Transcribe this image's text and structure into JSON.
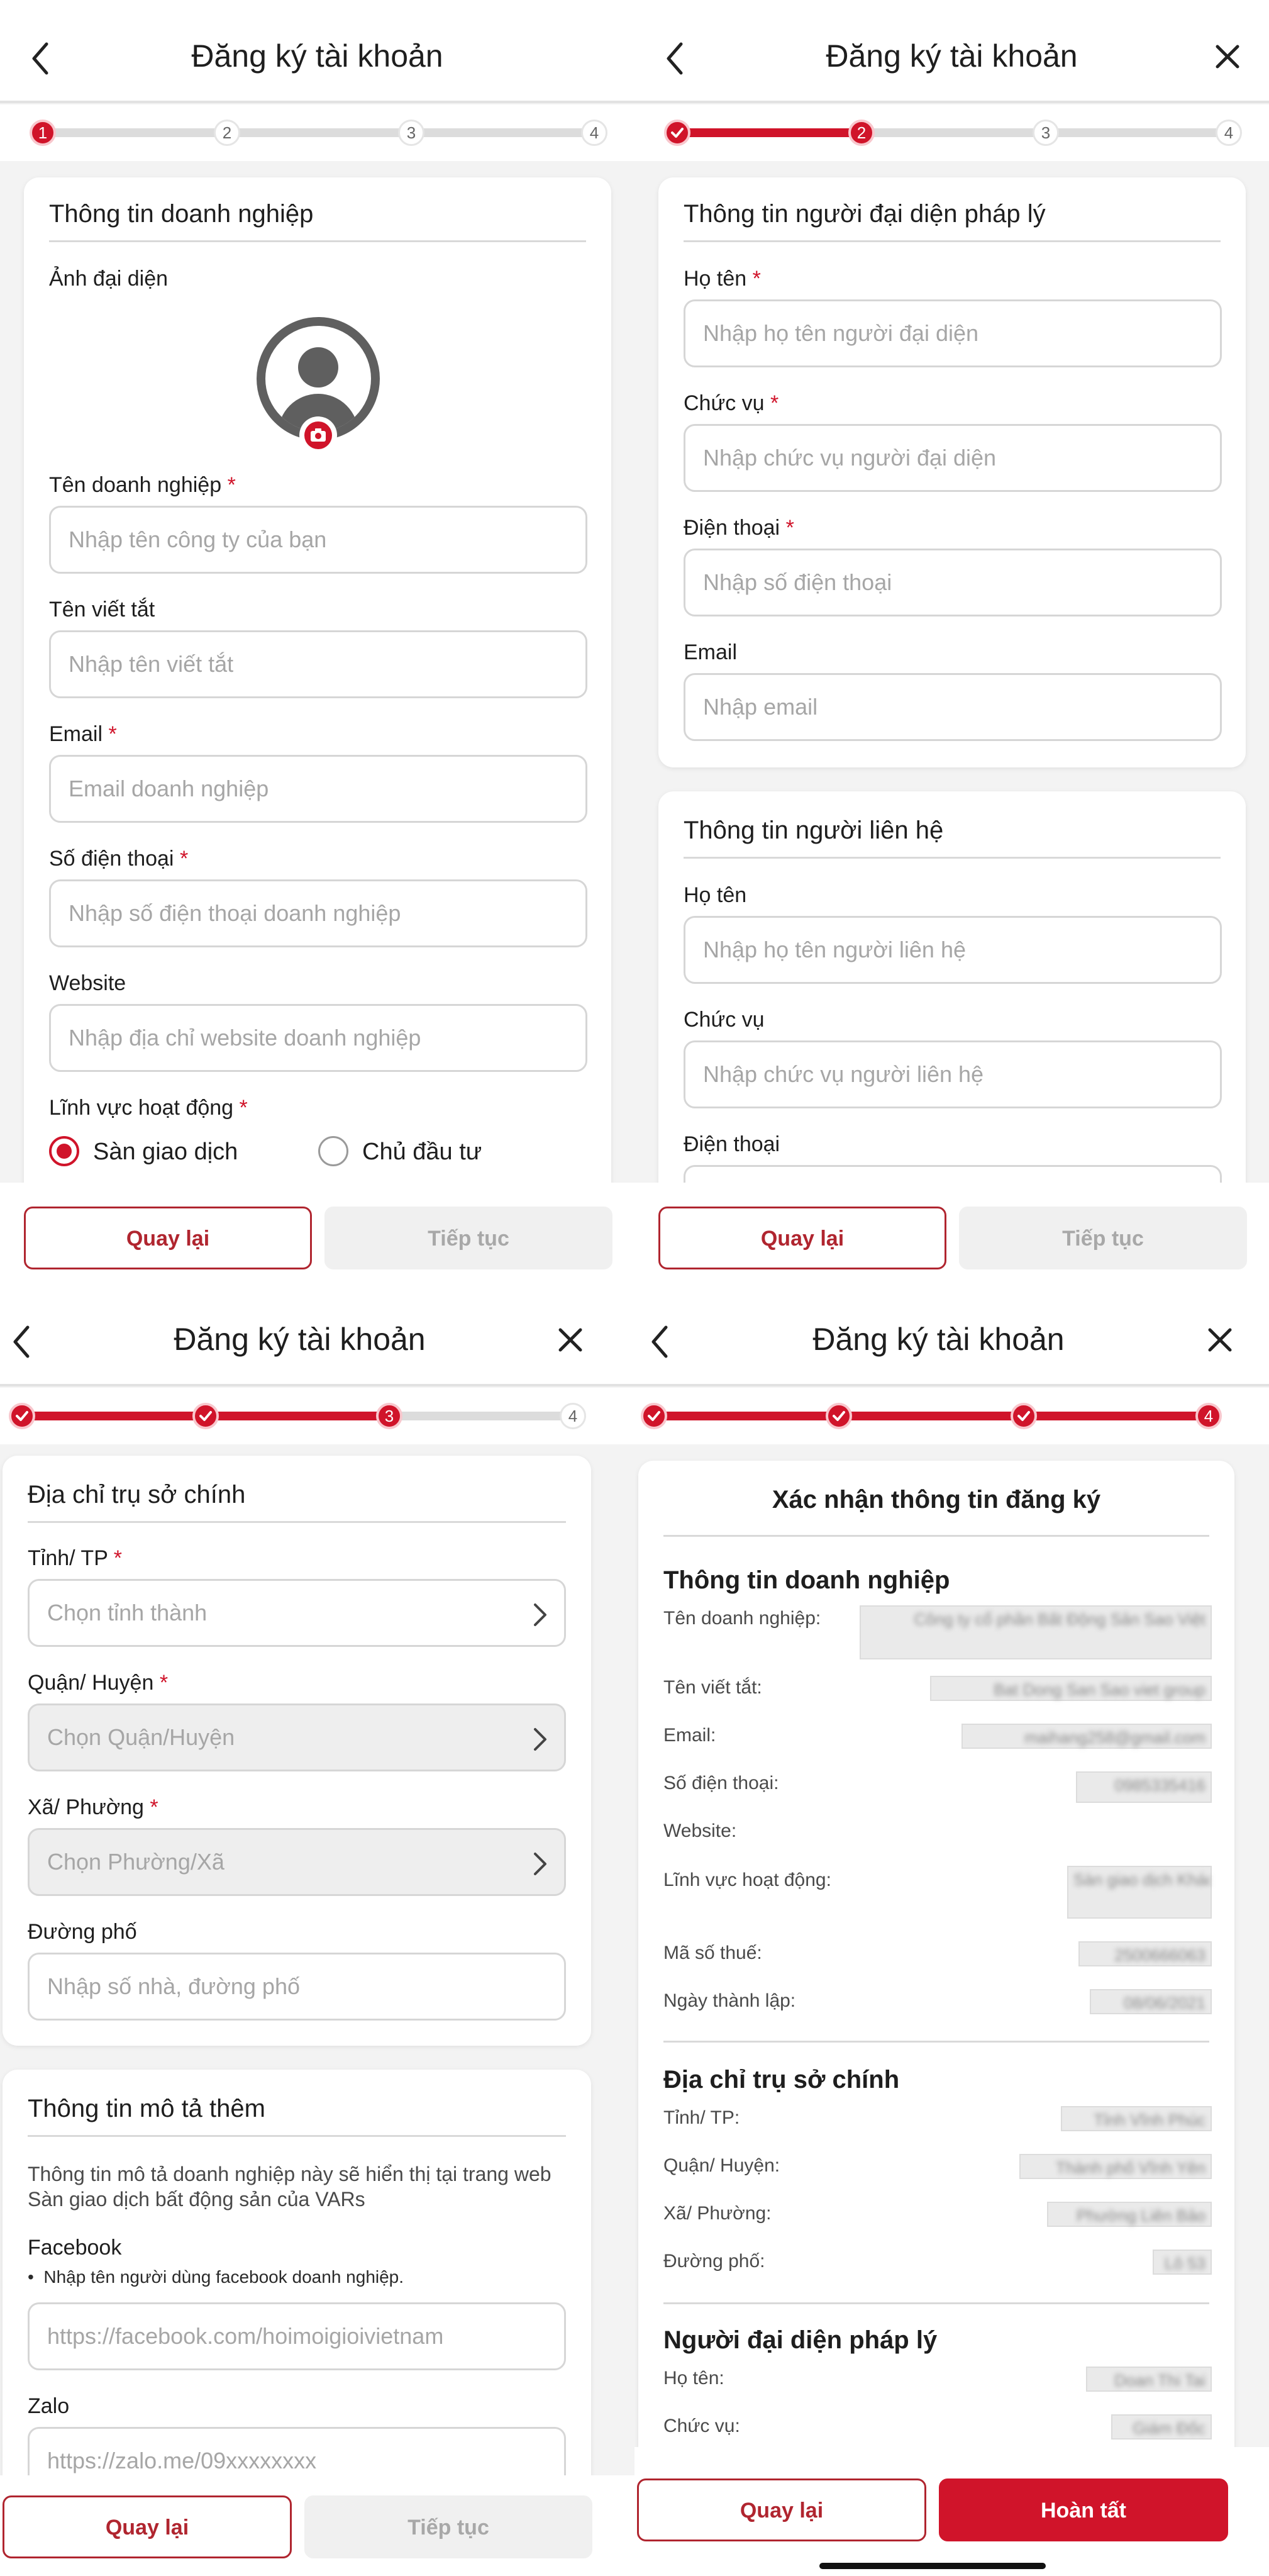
{
  "common": {
    "title": "Đăng ký tài khoản",
    "back_label": "Quay lại",
    "next_label": "Tiếp tục",
    "finish_label": "Hoàn tất",
    "req": "*",
    "colors": {
      "accent": "#d0142a",
      "track": "#dcdcdc",
      "field_border": "#d6d6d6"
    }
  },
  "screen1": {
    "steps": [
      "1",
      "2",
      "3",
      "4"
    ],
    "current_step": 1,
    "card_title": "Thông tin doanh nghiệp",
    "avatar_label": "Ảnh đại diện",
    "fields": [
      {
        "label": "Tên doanh nghiệp",
        "required": true,
        "placeholder": "Nhập tên công ty của bạn"
      },
      {
        "label": "Tên viết tắt",
        "required": false,
        "placeholder": "Nhập tên viết tắt"
      },
      {
        "label": "Email",
        "required": true,
        "placeholder": "Email doanh nghiệp"
      },
      {
        "label": "Số điện thoại",
        "required": true,
        "placeholder": "Nhập số điện thoại doanh nghiệp"
      },
      {
        "label": "Website",
        "required": false,
        "placeholder": "Nhập địa chỉ website doanh nghiệp"
      }
    ],
    "activity_label": "Lĩnh vực hoạt động",
    "radio_options": [
      "Sàn giao dịch",
      "Chủ đầu tư"
    ],
    "radio_selected": "Sàn giao dịch"
  },
  "screen2": {
    "steps": [
      "",
      "2",
      "3",
      "4"
    ],
    "current_step": 2,
    "legal_card_title": "Thông tin người đại diện pháp lý",
    "legal_fields": [
      {
        "label": "Họ tên",
        "required": true,
        "placeholder": "Nhập họ tên người đại diện"
      },
      {
        "label": "Chức vụ",
        "required": true,
        "placeholder": "Nhập chức vụ người đại diện"
      },
      {
        "label": "Điện thoại",
        "required": true,
        "placeholder": "Nhập số điện thoại"
      },
      {
        "label": "Email",
        "required": false,
        "placeholder": "Nhập email"
      }
    ],
    "contact_card_title": "Thông tin người liên hệ",
    "contact_fields": [
      {
        "label": "Họ tên",
        "placeholder": "Nhập họ tên người liên hệ"
      },
      {
        "label": "Chức vụ",
        "placeholder": "Nhập chức vụ người liên hệ"
      },
      {
        "label": "Điện thoại",
        "placeholder": ""
      }
    ]
  },
  "screen3": {
    "steps": [
      "",
      "",
      "3",
      "4"
    ],
    "current_step": 3,
    "address_card_title": "Địa chỉ trụ sở chính",
    "address_fields": [
      {
        "label": "Tỉnh/ TP",
        "required": true,
        "placeholder": "Chọn tỉnh thành",
        "select": true,
        "disabled": false
      },
      {
        "label": "Quận/ Huyện",
        "required": true,
        "placeholder": "Chọn Quận/Huyện",
        "select": true,
        "disabled": true
      },
      {
        "label": "Xã/ Phường",
        "required": true,
        "placeholder": "Chọn Phường/Xã",
        "select": true,
        "disabled": true
      },
      {
        "label": "Đường phố",
        "required": false,
        "placeholder": "Nhập số nhà, đường phố",
        "select": false,
        "disabled": false
      }
    ],
    "more_card_title": "Thông tin mô tả thêm",
    "more_desc": "Thông tin mô tả doanh nghiệp này sẽ hiển thị tại trang web Sàn giao dịch bất động sản của VARs",
    "facebook_label": "Facebook",
    "facebook_hint": "Nhập tên người dùng facebook doanh nghiệp.",
    "facebook_placeholder": "https://facebook.com/hoimoigioivietnam",
    "zalo_label": "Zalo",
    "zalo_placeholder": "https://zalo.me/09xxxxxxxx"
  },
  "screen4": {
    "steps": [
      "",
      "",
      "",
      "4"
    ],
    "current_step": 4,
    "confirm_title": "Xác nhận thông tin đăng ký",
    "sections": [
      {
        "title": "Thông tin doanh nghiệp",
        "rows": [
          {
            "label": "Tên doanh nghiệp:",
            "value": "Công ty cổ phần Bất Động Sản Sao Việt"
          },
          {
            "label": "Tên viết tắt:",
            "value": "Bat Dong San Sao viet group"
          },
          {
            "label": "Email:",
            "value": "maihang258@gmail.com"
          },
          {
            "label": "Số điện thoại:",
            "value": "0985335416"
          },
          {
            "label": "Website:",
            "value": ""
          },
          {
            "label": "Lĩnh vực hoạt động:",
            "value": "Sàn giao dịch Khác"
          },
          {
            "label": "Mã số thuế:",
            "value": "2500666063"
          },
          {
            "label": "Ngày thành lập:",
            "value": "08/06/2021"
          }
        ]
      },
      {
        "title": "Địa chỉ trụ sở chính",
        "rows": [
          {
            "label": "Tỉnh/ TP:",
            "value": "Tỉnh Vĩnh Phúc"
          },
          {
            "label": "Quận/ Huyện:",
            "value": "Thành phố Vĩnh Yên"
          },
          {
            "label": "Xã/ Phường:",
            "value": "Phường Liên Bảo"
          },
          {
            "label": "Đường phố:",
            "value": "Lô 53"
          }
        ]
      },
      {
        "title": "Người đại diện pháp lý",
        "rows": [
          {
            "label": "Họ tên:",
            "value": "Doan Thi Tai"
          },
          {
            "label": "Chức vụ:",
            "value": "Giám Đốc"
          }
        ]
      }
    ]
  }
}
